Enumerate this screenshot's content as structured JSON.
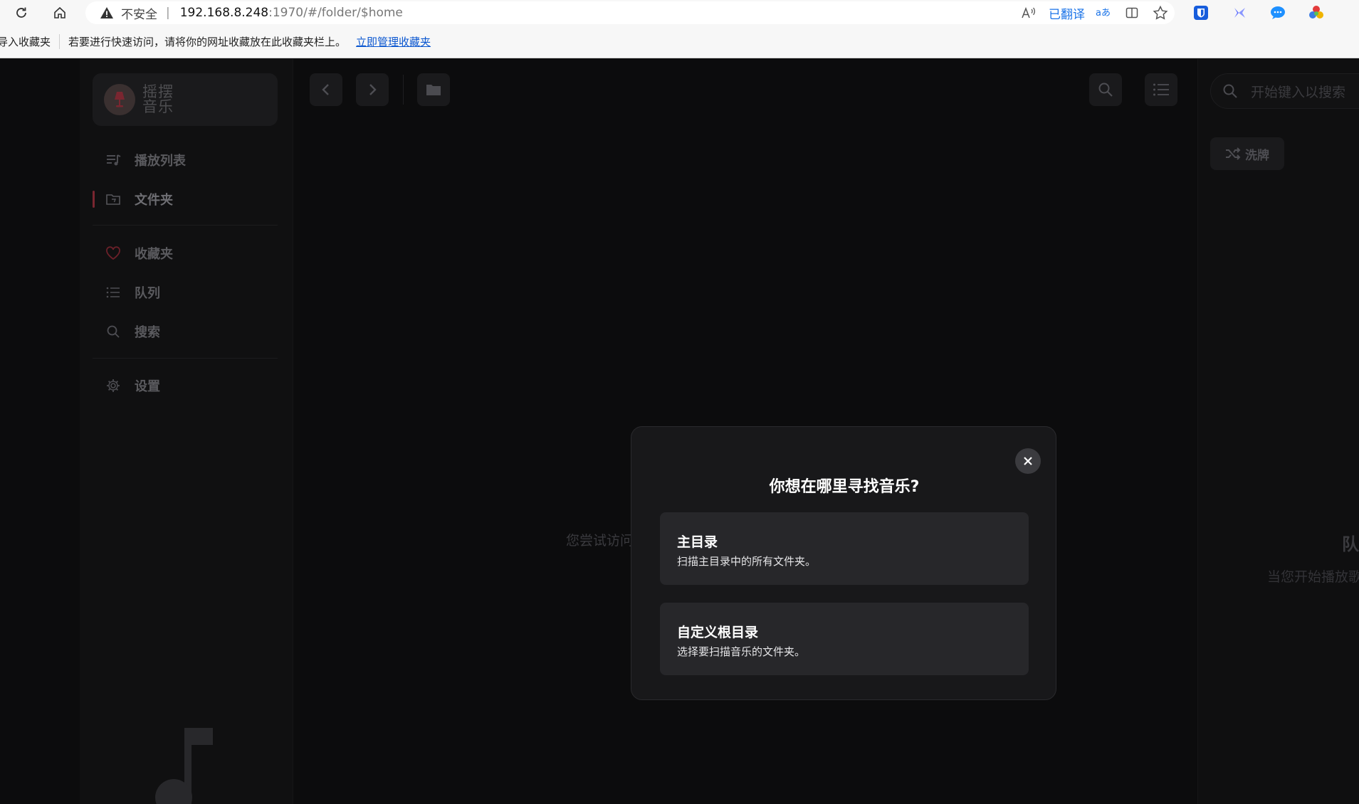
{
  "browser": {
    "security_label": "不安全",
    "separator": "|",
    "url_host": "192.168.8.248",
    "url_path": ":1970/#/folder/$home",
    "translated_label": "已翻译",
    "icons": [
      "reload-icon",
      "home-icon",
      "warning-icon",
      "read-aloud-icon",
      "translate-icon",
      "split-screen-icon",
      "favorite-star-icon",
      "bitwarden-icon",
      "extension-icon",
      "chat-icon",
      "colorful-extension-icon"
    ]
  },
  "bookmarks_bar": {
    "import_label": "导入收藏夹",
    "hint": "若要进行快速访问，请将你的网址收藏放在此收藏夹栏上。",
    "manage_link": "立即管理收藏夹"
  },
  "app": {
    "logo_text_line1": "摇摆",
    "logo_text_line2": "音乐",
    "nav": {
      "playlists": "播放列表",
      "folders": "文件夹",
      "favorites": "收藏夹",
      "queue": "队列",
      "search": "搜索",
      "settings": "设置"
    },
    "active_nav": "folders",
    "accent_color": "#7a2630",
    "empty_hint": "您尝试访问",
    "search_placeholder": "开始键入以搜索",
    "shuffle_label": "洗牌",
    "queue_title": "队",
    "queue_hint": "当您开始播放歌"
  },
  "modal": {
    "title": "你想在哪里寻找音乐?",
    "options": [
      {
        "title": "主目录",
        "description": "扫描主目录中的所有文件夹。"
      },
      {
        "title": "自定义根目录",
        "description": "选择要扫描音乐的文件夹。"
      }
    ]
  }
}
